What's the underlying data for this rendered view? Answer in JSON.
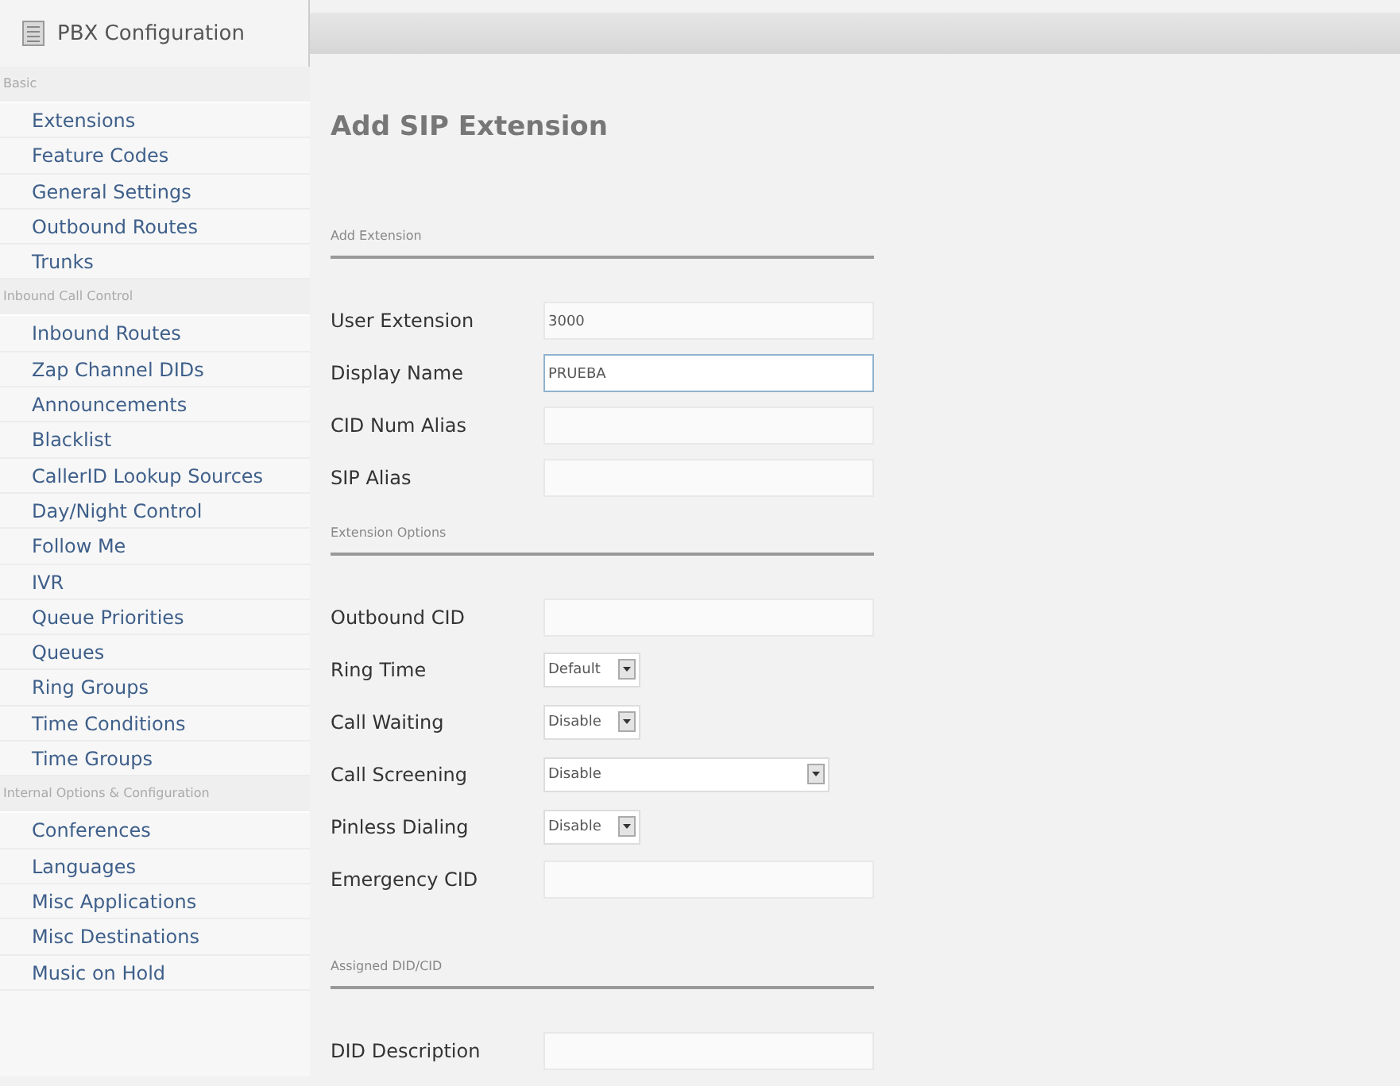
{
  "tab": {
    "label": "PBX Configuration"
  },
  "sidebar": {
    "groups": [
      {
        "heading": "Basic",
        "items": [
          "Extensions",
          "Feature Codes",
          "General Settings",
          "Outbound Routes",
          "Trunks"
        ]
      },
      {
        "heading": "Inbound Call Control",
        "items": [
          "Inbound Routes",
          "Zap Channel DIDs",
          "Announcements",
          "Blacklist",
          "CallerID Lookup Sources",
          "Day/Night Control",
          "Follow Me",
          "IVR",
          "Queue Priorities",
          "Queues",
          "Ring Groups",
          "Time Conditions",
          "Time Groups"
        ]
      },
      {
        "heading": "Internal Options & Configuration",
        "items": [
          "Conferences",
          "Languages",
          "Misc Applications",
          "Misc Destinations",
          "Music on Hold"
        ]
      }
    ]
  },
  "page_title": "Add SIP Extension",
  "sections": [
    {
      "heading": "Add Extension",
      "fields": [
        {
          "kind": "text",
          "label": "User Extension",
          "value": "3000",
          "focused": false
        },
        {
          "kind": "text",
          "label": "Display Name",
          "value": "PRUEBA",
          "focused": true
        },
        {
          "kind": "text",
          "label": "CID Num Alias",
          "focused": false
        },
        {
          "kind": "text",
          "label": "SIP Alias",
          "focused": false
        }
      ]
    },
    {
      "heading": "Extension Options",
      "fields": [
        {
          "kind": "text",
          "label": "Outbound CID",
          "focused": false
        },
        {
          "kind": "select",
          "label": "Ring Time",
          "value": "Default",
          "wide": false
        },
        {
          "kind": "select",
          "label": "Call Waiting",
          "value": "Disable",
          "wide": false
        },
        {
          "kind": "select",
          "label": "Call Screening",
          "value": "Disable",
          "wide": true
        },
        {
          "kind": "select",
          "label": "Pinless Dialing",
          "value": "Disable",
          "wide": false
        },
        {
          "kind": "text",
          "label": "Emergency CID",
          "focused": false
        }
      ]
    },
    {
      "heading": "Assigned DID/CID",
      "fields": [
        {
          "kind": "text",
          "label": "DID Description",
          "focused": false
        }
      ]
    }
  ]
}
